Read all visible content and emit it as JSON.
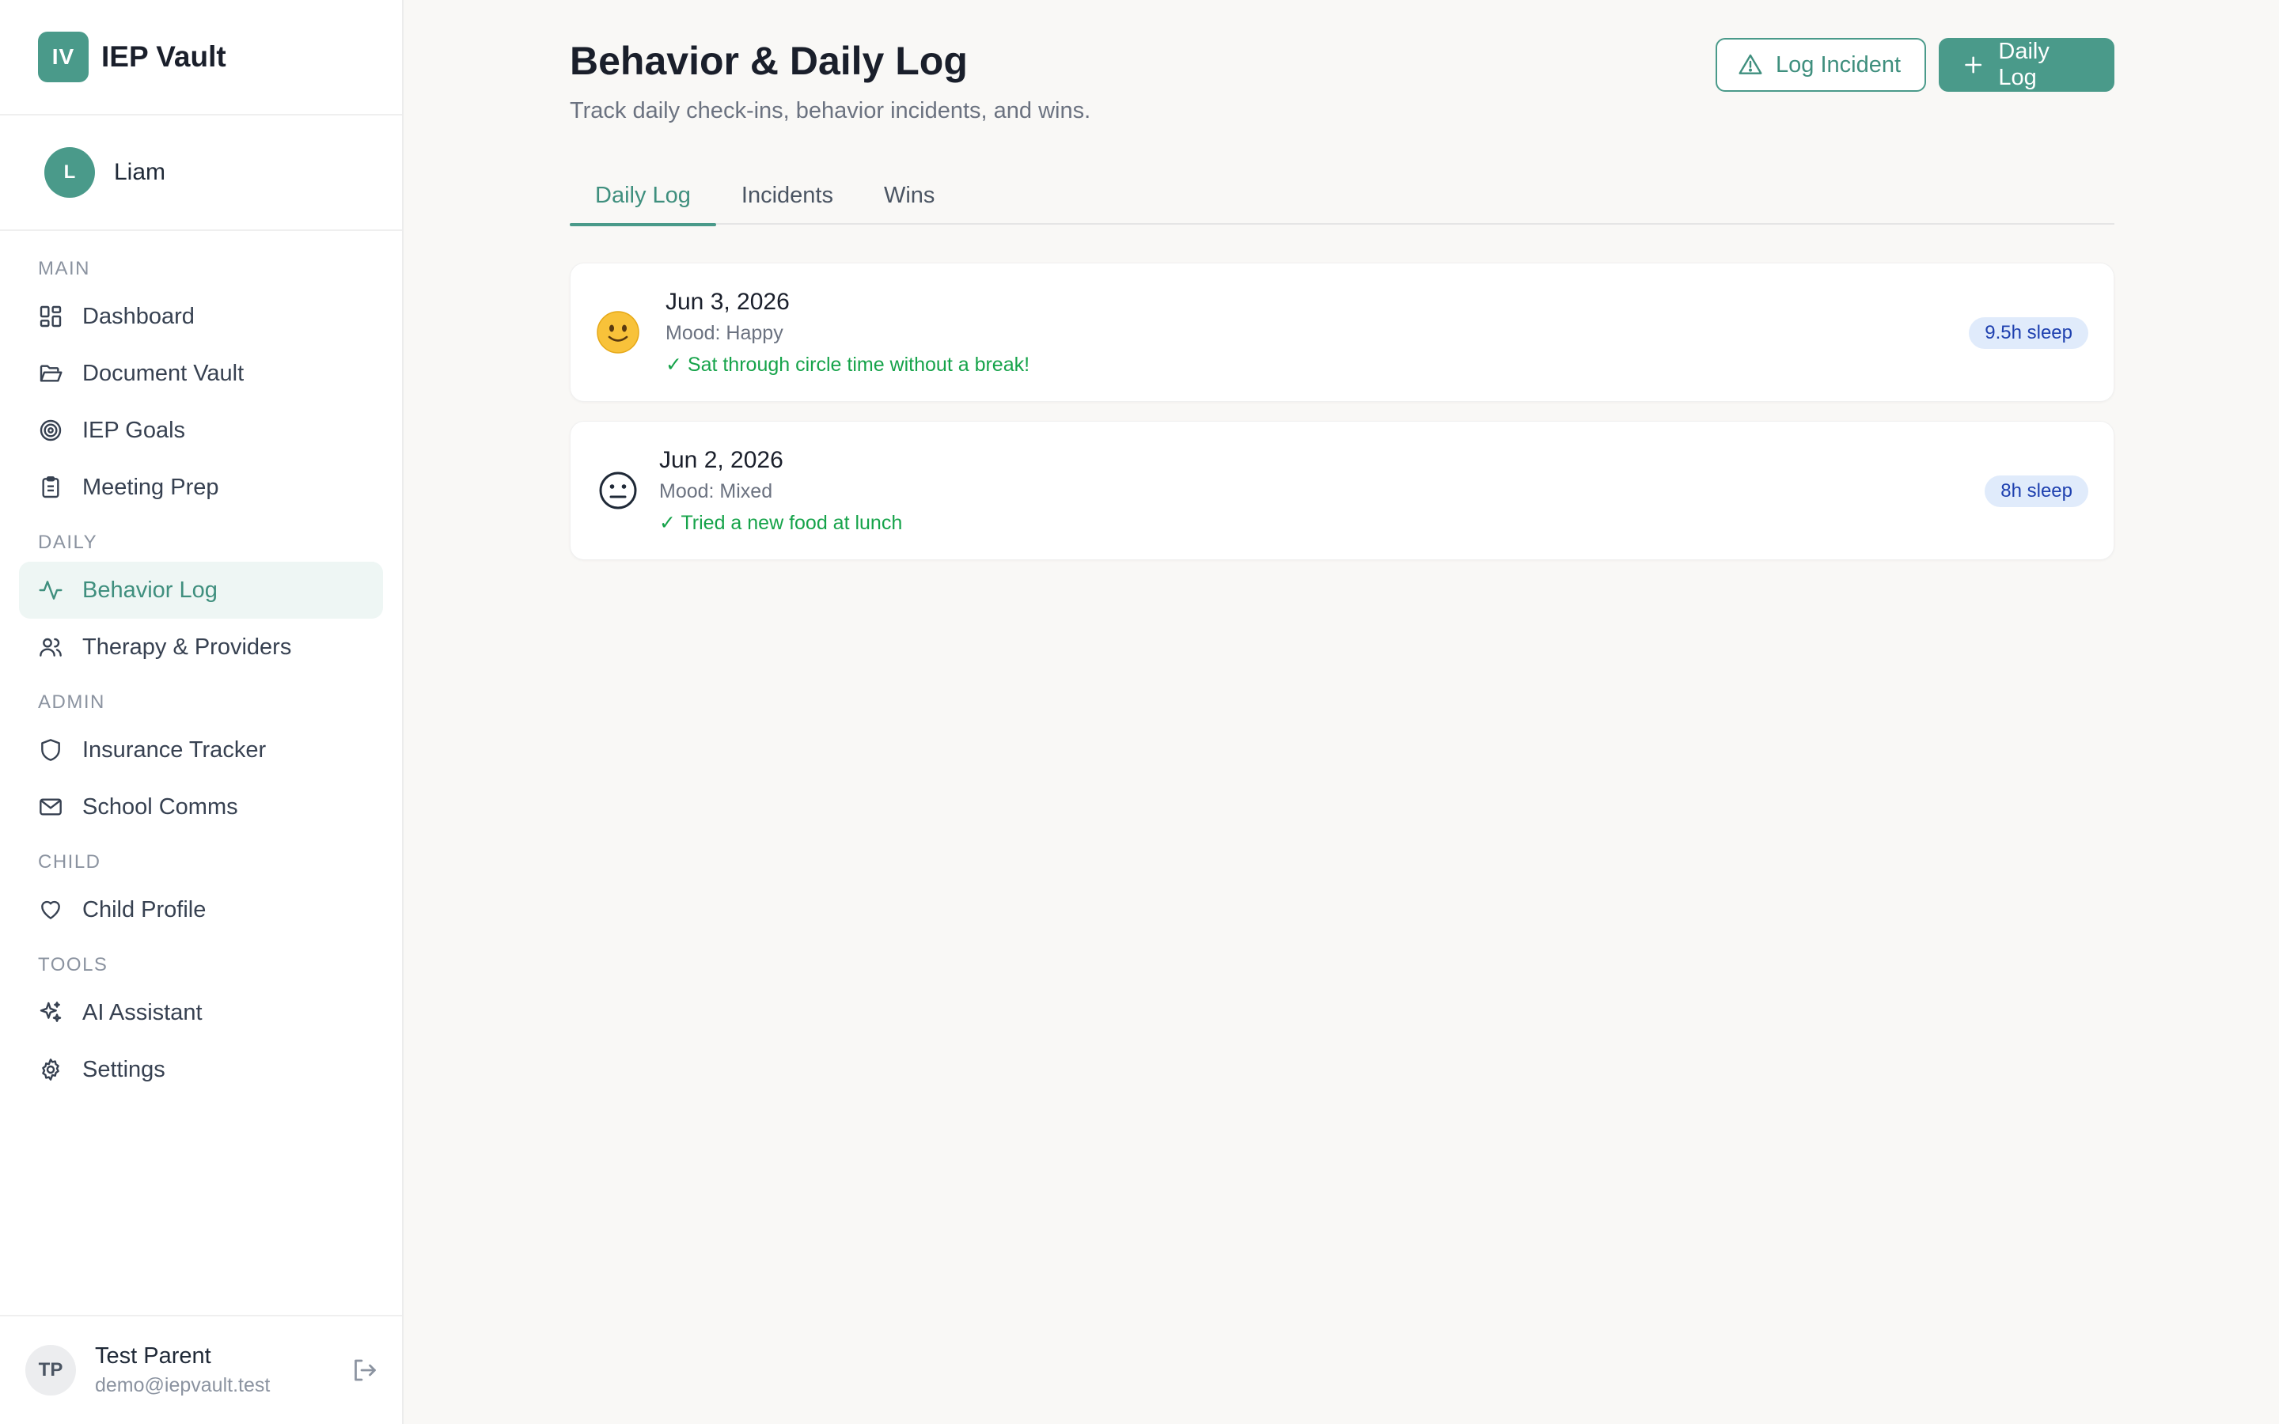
{
  "app": {
    "logo_initials": "IV",
    "name": "IEP Vault"
  },
  "child": {
    "initial": "L",
    "name": "Liam"
  },
  "nav": {
    "sections": [
      {
        "label": "MAIN",
        "items": [
          {
            "label": "Dashboard",
            "icon": "grid-icon"
          },
          {
            "label": "Document Vault",
            "icon": "folder-open-icon"
          },
          {
            "label": "IEP Goals",
            "icon": "target-icon"
          },
          {
            "label": "Meeting Prep",
            "icon": "clipboard-icon"
          }
        ]
      },
      {
        "label": "DAILY",
        "items": [
          {
            "label": "Behavior Log",
            "icon": "activity-icon",
            "active": true
          },
          {
            "label": "Therapy & Providers",
            "icon": "users-icon"
          }
        ]
      },
      {
        "label": "ADMIN",
        "items": [
          {
            "label": "Insurance Tracker",
            "icon": "shield-icon"
          },
          {
            "label": "School Comms",
            "icon": "mail-icon"
          }
        ]
      },
      {
        "label": "CHILD",
        "items": [
          {
            "label": "Child Profile",
            "icon": "heart-icon"
          }
        ]
      },
      {
        "label": "TOOLS",
        "items": [
          {
            "label": "AI Assistant",
            "icon": "sparkles-icon"
          },
          {
            "label": "Settings",
            "icon": "gear-icon"
          }
        ]
      }
    ]
  },
  "user": {
    "initials": "TP",
    "name": "Test Parent",
    "email": "demo@iepvault.test"
  },
  "page": {
    "title": "Behavior & Daily Log",
    "subtitle": "Track daily check-ins, behavior incidents, and wins.",
    "log_incident_label": "Log Incident",
    "daily_log_label": "Daily Log"
  },
  "tabs": [
    {
      "label": "Daily Log",
      "active": true
    },
    {
      "label": "Incidents"
    },
    {
      "label": "Wins"
    }
  ],
  "logs": [
    {
      "date": "Jun 3, 2026",
      "mood": "Mood: Happy",
      "win": "✓ Sat through circle time without a break!",
      "sleep": "9.5h sleep",
      "mood_icon": "smile-emoji-icon"
    },
    {
      "date": "Jun 2, 2026",
      "mood": "Mood: Mixed",
      "win": "✓ Tried a new food at lunch",
      "sleep": "8h sleep",
      "mood_icon": "neutral-face-icon"
    }
  ],
  "colors": {
    "accent": "#4a9a8a",
    "win_green": "#16a34a",
    "badge_bg": "#e0ebfb",
    "badge_text": "#1e40af"
  }
}
